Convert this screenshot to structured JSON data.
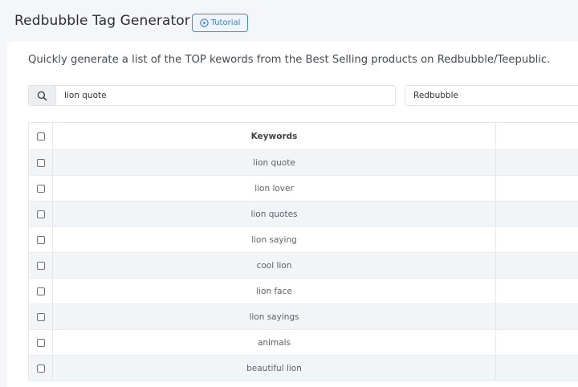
{
  "header": {
    "title": "Redbubble Tag Generator",
    "tutorial_label": "Tutorial"
  },
  "main": {
    "description": "Quickly generate a list of the TOP kewords from the Best Selling products on Redbubble/Teepublic.",
    "search": {
      "value": "lion quote",
      "icon": "search-icon"
    },
    "platform_select": {
      "value": "Redbubble"
    }
  },
  "table": {
    "header": "Keywords",
    "rows": [
      "lion quote",
      "lion lover",
      "lion quotes",
      "lion saying",
      "cool lion",
      "lion face",
      "lion sayings",
      "animals",
      "beautiful lion"
    ]
  }
}
